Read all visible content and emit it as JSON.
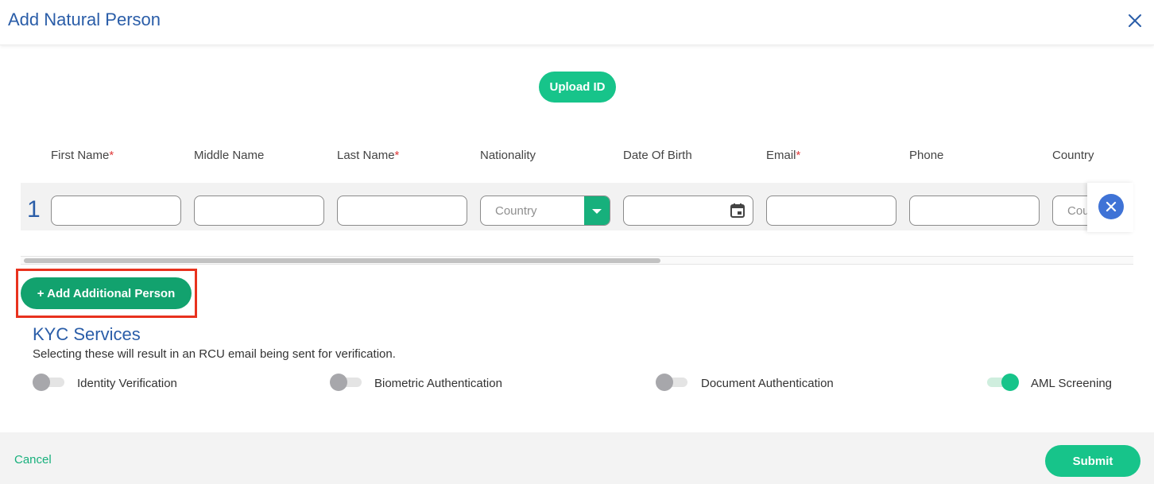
{
  "header": {
    "title": "Add Natural Person",
    "close_icon": "close-icon"
  },
  "upload": {
    "label": "Upload ID"
  },
  "columns": [
    {
      "label": "First Name",
      "required": true
    },
    {
      "label": "Middle Name",
      "required": false
    },
    {
      "label": "Last Name",
      "required": true
    },
    {
      "label": "Nationality",
      "required": false
    },
    {
      "label": "Date Of Birth",
      "required": false
    },
    {
      "label": "Email",
      "required": true
    },
    {
      "label": "Phone",
      "required": false
    },
    {
      "label": "Country",
      "required": false
    }
  ],
  "required_mark": "*",
  "row": {
    "number": "1",
    "nationality_placeholder": "Country",
    "country_placeholder": "Cou"
  },
  "add_person": {
    "label": "+ Add Additional Person"
  },
  "kyc": {
    "title": "KYC Services",
    "subtitle": "Selecting these will result in an RCU email being sent for verification.",
    "services": [
      {
        "label": "Identity Verification",
        "enabled": false
      },
      {
        "label": "Biometric Authentication",
        "enabled": false
      },
      {
        "label": "Document Authentication",
        "enabled": false
      },
      {
        "label": "AML Screening",
        "enabled": true
      }
    ]
  },
  "footer": {
    "cancel_label": "Cancel",
    "submit_label": "Submit"
  },
  "colors": {
    "brand_blue": "#2a5da8",
    "accent_green": "#17c48a",
    "dark_green": "#12a26e",
    "highlight_red": "#e8321e"
  }
}
